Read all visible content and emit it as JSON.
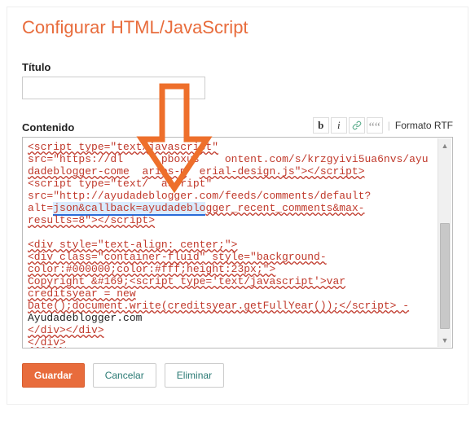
{
  "heading": "Configurar HTML/JavaScript",
  "fields": {
    "title_label": "Título",
    "title_value": "",
    "content_label": "Contenido"
  },
  "toolbar": {
    "bold": "b",
    "italic": "i",
    "link_icon": "link-icon",
    "quote_icon": "quote-icon",
    "sep": "|",
    "rtf": "Formato RTF"
  },
  "editor": {
    "line1a": "<script type=\"text/javascript\"",
    "line2a": "src=\"https://dl",
    "line2b": "pboxus",
    "line2c": "ontent.com/s/krzgyivi5ua6nvs/ayu",
    "line3a": "dadeblogger-come",
    "line3b": "arios-m",
    "line3c": "erial-design.js\"></script>",
    "line4a": "<script type=\"text/",
    "line4b": "ascript\"",
    "line5a": "src=\"http://ayudadeblogger.com/feeds/comments/default?",
    "line6a": "alt=",
    "line6hl": "json&callback=ayudadeblo",
    "line6b": "gger_recent_comments&max-",
    "line7a": "results=8\"></script>",
    "blank": "",
    "line8a": "<div style=\"text-align: center;\">",
    "line9a": "<div class=\"container-fluid\" style=\"background-",
    "line10a": "color:#000000;color:#fff;height:23px;\">",
    "line11a": "Copyright &#169;<script type='text/javascript'>var",
    "line12a": "creditsyear = new",
    "line13a": "Date();document.write(creditsyear.getFullYear());</script> -",
    "line14a": "Ayudadeblogger.com",
    "line15a": "</div></div>",
    "line16a": "</div>"
  },
  "buttons": {
    "save": "Guardar",
    "cancel": "Cancelar",
    "delete": "Eliminar"
  }
}
